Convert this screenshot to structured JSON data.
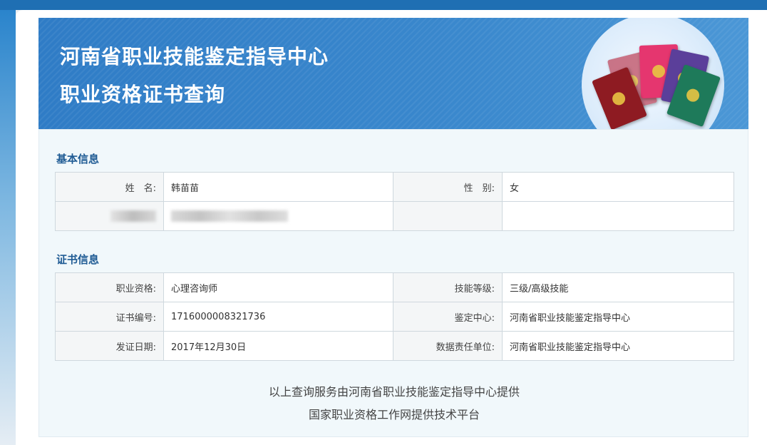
{
  "header": {
    "title_line1": "河南省职业技能鉴定指导中心",
    "title_line2": "职业资格证书查询"
  },
  "basic_info": {
    "section_title": "基本信息",
    "rows": [
      {
        "label1": "姓　名:",
        "value1": "韩苗苗",
        "label2": "性　别:",
        "value2": "女"
      },
      {
        "label1": "",
        "value1": "",
        "label2": "",
        "value2": ""
      }
    ]
  },
  "cert_info": {
    "section_title": "证书信息",
    "rows": [
      {
        "label1": "职业资格:",
        "value1": "心理咨询师",
        "label2": "技能等级:",
        "value2": "三级/高级技能"
      },
      {
        "label1": "证书编号:",
        "value1": "1716000008321736",
        "label2": "鉴定中心:",
        "value2": "河南省职业技能鉴定指导中心"
      },
      {
        "label1": "发证日期:",
        "value1": "2017年12月30日",
        "label2": "数据责任单位:",
        "value2": "河南省职业技能鉴定指导中心"
      }
    ]
  },
  "footer": {
    "line1": "以上查询服务由河南省职业技能鉴定指导中心提供",
    "line2": "国家职业资格工作网提供技术平台"
  },
  "colors": {
    "banner": "#2f7cc6",
    "section_title": "#1f5b94",
    "content_bg": "#f1f8fb"
  },
  "icons": [
    "certificate-books-illustration"
  ]
}
